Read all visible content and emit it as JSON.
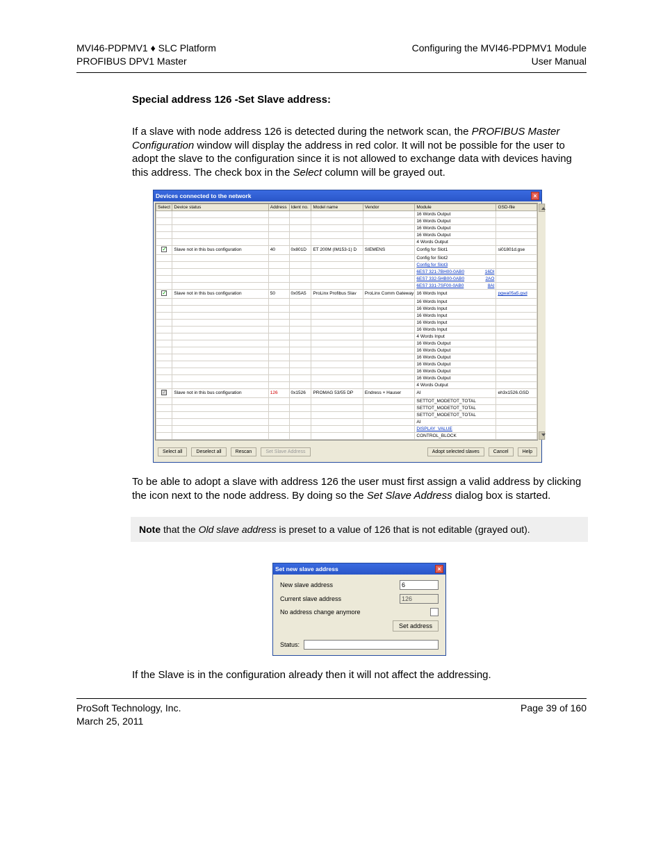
{
  "header": {
    "left1": "MVI46-PDPMV1 ♦ SLC Platform",
    "left2": "PROFIBUS DPV1 Master",
    "right1": "Configuring the MVI46-PDPMV1 Module",
    "right2": "User Manual"
  },
  "section_title": "Special address 126 -Set Slave address:",
  "para1": "If a slave with node address 126 is detected during the network scan, the PROFIBUS Master Configuration window will display the address in red color. It will not be possible for the user to adopt the slave to the configuration since it is not allowed to exchange data with devices having this address. The check box in the Select column will be grayed out.",
  "para1_italic_phrase": "PROFIBUS Master Configuration",
  "para1_italic_phrase2": "Select",
  "devices_window": {
    "title": "Devices connected to the network",
    "columns": [
      "Select",
      "Device status",
      "Address",
      "Ident no.",
      "Model name",
      "Vendor",
      "Module",
      "GSD-file"
    ],
    "rows": [
      {
        "sel": null,
        "stat": "",
        "addr": "",
        "ident": "",
        "model": "",
        "vendor": "",
        "module": "16 Words Output",
        "gsd": ""
      },
      {
        "sel": null,
        "stat": "",
        "addr": "",
        "ident": "",
        "model": "",
        "vendor": "",
        "module": "16 Words Output",
        "gsd": ""
      },
      {
        "sel": null,
        "stat": "",
        "addr": "",
        "ident": "",
        "model": "",
        "vendor": "",
        "module": "16 Words Output",
        "gsd": ""
      },
      {
        "sel": null,
        "stat": "",
        "addr": "",
        "ident": "",
        "model": "",
        "vendor": "",
        "module": "16 Words Output",
        "gsd": ""
      },
      {
        "sel": null,
        "stat": "",
        "addr": "",
        "ident": "",
        "model": "",
        "vendor": "",
        "module": "4 Words Output",
        "gsd": ""
      },
      {
        "sel": "on",
        "stat": "Slave not in this bus configuration",
        "addr": "40",
        "ident": "0x801D",
        "model": "ET 200M (IM153-1) D",
        "vendor": "SIEMENS",
        "module": "Config for Slot1",
        "gsd": "si01801d.gse"
      },
      {
        "sel": null,
        "stat": "",
        "addr": "",
        "ident": "",
        "model": "",
        "vendor": "",
        "module": "Config for Slot2",
        "gsd": ""
      },
      {
        "sel": null,
        "stat": "",
        "addr": "",
        "ident": "",
        "model": "",
        "vendor": "",
        "module_blue": "Config for Slot3",
        "gsd": ""
      },
      {
        "sel": null,
        "stat": "",
        "addr": "",
        "ident": "",
        "model": "",
        "vendor": "",
        "module_blue": "6ES7 321-7BH00-0AB0",
        "mod_suffix": "16DI",
        "gsd": ""
      },
      {
        "sel": null,
        "stat": "",
        "addr": "",
        "ident": "",
        "model": "",
        "vendor": "",
        "module_blue": "6ES7 332-5HB00-0AB0",
        "mod_suffix": "2AO",
        "gsd": ""
      },
      {
        "sel": null,
        "stat": "",
        "addr": "",
        "ident": "",
        "model": "",
        "vendor": "",
        "module_blue": "6ES7 331-7SF00-0AB0",
        "mod_suffix": "8AI",
        "gsd": ""
      },
      {
        "sel": "on",
        "stat": "Slave not in this bus configuration",
        "addr": "50",
        "ident": "0x05A5",
        "model": "ProLinx Profibus Slav",
        "vendor": "ProLinx Comm Gateway",
        "module": "16 Words Input",
        "gsd_blue": "pgwa05a5.gsd"
      },
      {
        "sel": null,
        "stat": "",
        "addr": "",
        "ident": "",
        "model": "",
        "vendor": "",
        "module": "16 Words Input",
        "gsd": ""
      },
      {
        "sel": null,
        "stat": "",
        "addr": "",
        "ident": "",
        "model": "",
        "vendor": "",
        "module": "16 Words Input",
        "gsd": ""
      },
      {
        "sel": null,
        "stat": "",
        "addr": "",
        "ident": "",
        "model": "",
        "vendor": "",
        "module": "16 Words Input",
        "gsd": ""
      },
      {
        "sel": null,
        "stat": "",
        "addr": "",
        "ident": "",
        "model": "",
        "vendor": "",
        "module": "16 Words Input",
        "gsd": ""
      },
      {
        "sel": null,
        "stat": "",
        "addr": "",
        "ident": "",
        "model": "",
        "vendor": "",
        "module": "16 Words Input",
        "gsd": ""
      },
      {
        "sel": null,
        "stat": "",
        "addr": "",
        "ident": "",
        "model": "",
        "vendor": "",
        "module": "4 Words Input",
        "gsd": ""
      },
      {
        "sel": null,
        "stat": "",
        "addr": "",
        "ident": "",
        "model": "",
        "vendor": "",
        "module": "16 Words Output",
        "gsd": ""
      },
      {
        "sel": null,
        "stat": "",
        "addr": "",
        "ident": "",
        "model": "",
        "vendor": "",
        "module": "16 Words Output",
        "gsd": ""
      },
      {
        "sel": null,
        "stat": "",
        "addr": "",
        "ident": "",
        "model": "",
        "vendor": "",
        "module": "16 Words Output",
        "gsd": ""
      },
      {
        "sel": null,
        "stat": "",
        "addr": "",
        "ident": "",
        "model": "",
        "vendor": "",
        "module": "16 Words Output",
        "gsd": ""
      },
      {
        "sel": null,
        "stat": "",
        "addr": "",
        "ident": "",
        "model": "",
        "vendor": "",
        "module": "16 Words Output",
        "gsd": ""
      },
      {
        "sel": null,
        "stat": "",
        "addr": "",
        "ident": "",
        "model": "",
        "vendor": "",
        "module": "16 Words Output",
        "gsd": ""
      },
      {
        "sel": null,
        "stat": "",
        "addr": "",
        "ident": "",
        "model": "",
        "vendor": "",
        "module": "4 Words Output",
        "gsd": ""
      },
      {
        "sel": "gray",
        "stat": "Slave not in this bus configuration",
        "addr_red": "126",
        "ident": "0x1526",
        "model": "PROMAG 53/55 DP",
        "vendor": "Endress + Hauser",
        "module": "AI",
        "gsd": "eh3x1526.GSD"
      },
      {
        "sel": null,
        "stat": "",
        "addr": "",
        "ident": "",
        "model": "",
        "vendor": "",
        "module": "SETTOT_MODETOT_TOTAL",
        "gsd": ""
      },
      {
        "sel": null,
        "stat": "",
        "addr": "",
        "ident": "",
        "model": "",
        "vendor": "",
        "module": "SETTOT_MODETOT_TOTAL",
        "gsd": ""
      },
      {
        "sel": null,
        "stat": "",
        "addr": "",
        "ident": "",
        "model": "",
        "vendor": "",
        "module": "SETTOT_MODETOT_TOTAL",
        "gsd": ""
      },
      {
        "sel": null,
        "stat": "",
        "addr": "",
        "ident": "",
        "model": "",
        "vendor": "",
        "module": "AI",
        "gsd": ""
      },
      {
        "sel": null,
        "stat": "",
        "addr": "",
        "ident": "",
        "model": "",
        "vendor": "",
        "module_blue": "DISPLAY_VALUE",
        "gsd": ""
      },
      {
        "sel": null,
        "stat": "",
        "addr": "",
        "ident": "",
        "model": "",
        "vendor": "",
        "module": "CONTROL_BLOCK",
        "gsd": ""
      }
    ],
    "buttons": {
      "select_all": "Select all",
      "deselect_all": "Deselect all",
      "rescan": "Rescan",
      "set_slave": "Set Slave Address",
      "adopt": "Adopt selected slaves",
      "cancel": "Cancel",
      "help": "Help"
    }
  },
  "para2_a": "To be able to adopt a slave with address 126 the user must first assign a valid address by clicking the icon next to the node address. By doing so the ",
  "para2_italic": "Set Slave Address",
  "para2_b": " dialog box is started.",
  "note_a": "Note",
  "note_b": " that the ",
  "note_italic": "Old slave address",
  "note_c": " is preset to a value of 126 that is not editable (grayed out).",
  "dialog": {
    "title": "Set new slave address",
    "new_label": "New slave address",
    "new_value": "6",
    "cur_label": "Current slave address",
    "cur_value": "126",
    "noaddr_label": "No address change anymore",
    "set_btn": "Set address",
    "status_label": "Status:"
  },
  "para3": "If the Slave is in the configuration already then it will not affect the addressing.",
  "footer": {
    "left1": "ProSoft Technology, Inc.",
    "left2": "March 25, 2011",
    "right": "Page 39 of 160"
  }
}
